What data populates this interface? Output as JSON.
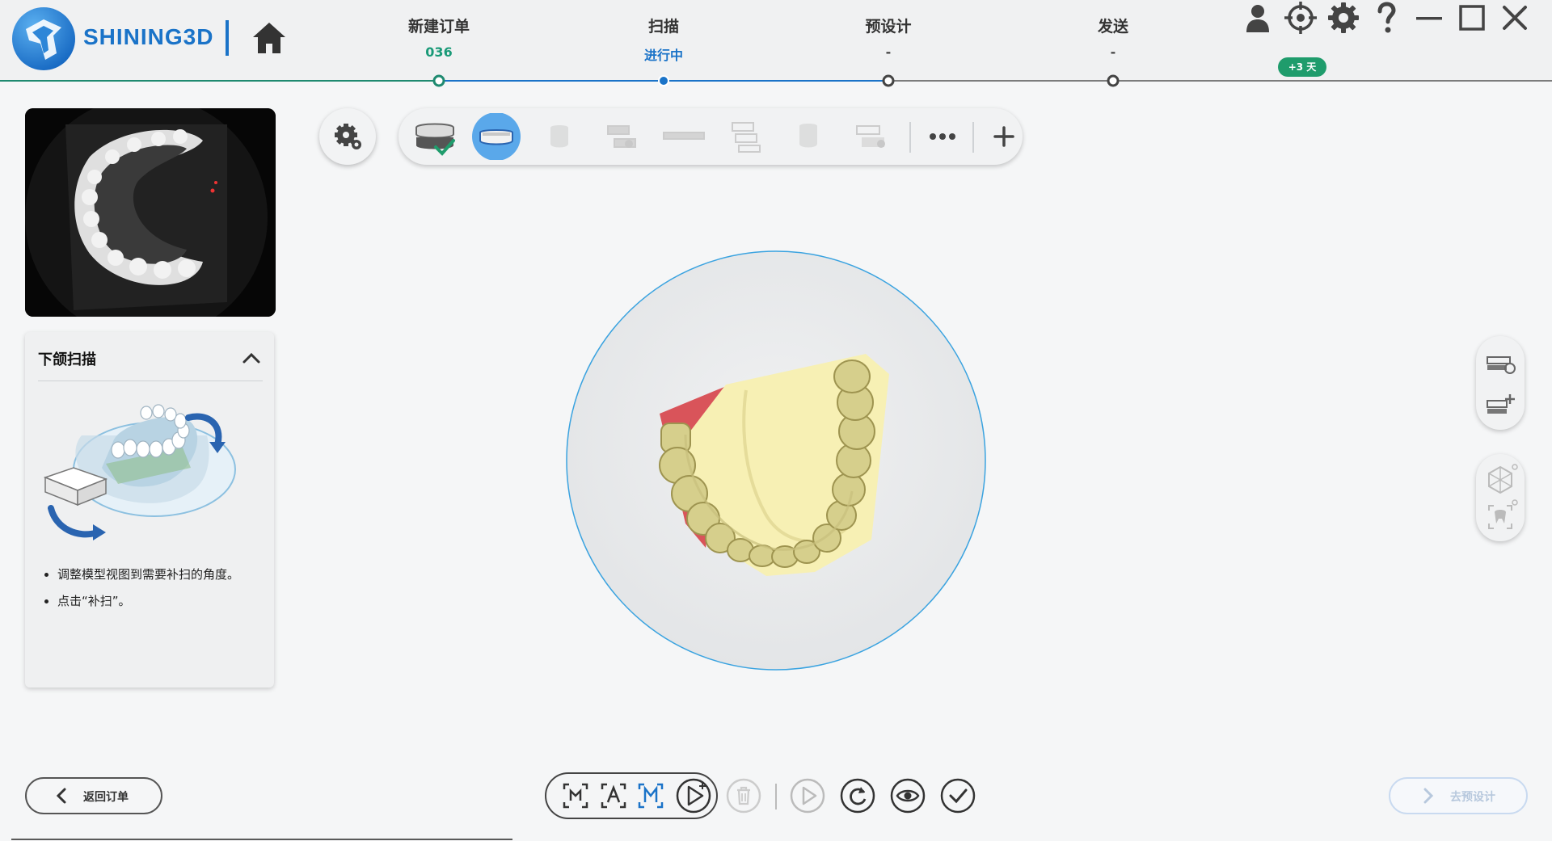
{
  "header": {
    "brand": "SHINING3D",
    "steps": [
      {
        "label": "新建订单",
        "sub": "036",
        "state": "done"
      },
      {
        "label": "扫描",
        "sub": "进行中",
        "state": "active"
      },
      {
        "label": "预设计",
        "sub": "-",
        "state": "pending"
      },
      {
        "label": "发送",
        "sub": "-",
        "state": "pending"
      }
    ],
    "trial_badge": "+3 天",
    "icons": [
      "user-icon",
      "target-icon",
      "gear-icon",
      "help-icon",
      "minimize-icon",
      "maximize-icon",
      "close-icon"
    ]
  },
  "instructions": {
    "title": "下颌扫描",
    "items": [
      "调整模型视图到需要补扫的角度。",
      "点击“补扫”。"
    ]
  },
  "toolbar": {
    "items": [
      "upper-jaw-done-icon",
      "lower-jaw-active-icon",
      "upper-icon",
      "occlusion-icon",
      "bite-icon",
      "bite-alt-icon",
      "die-icon",
      "die-alt-icon",
      "more-icon",
      "add-icon"
    ]
  },
  "bottom": {
    "back_label": "返回订单",
    "next_label": "去预设计"
  },
  "colors": {
    "brand_blue": "#1a73c8",
    "accent_green": "#1f9c6c",
    "scan_cream": "#f6efb2",
    "scan_teeth": "#d7cf8a",
    "scan_red": "#d9545a"
  }
}
